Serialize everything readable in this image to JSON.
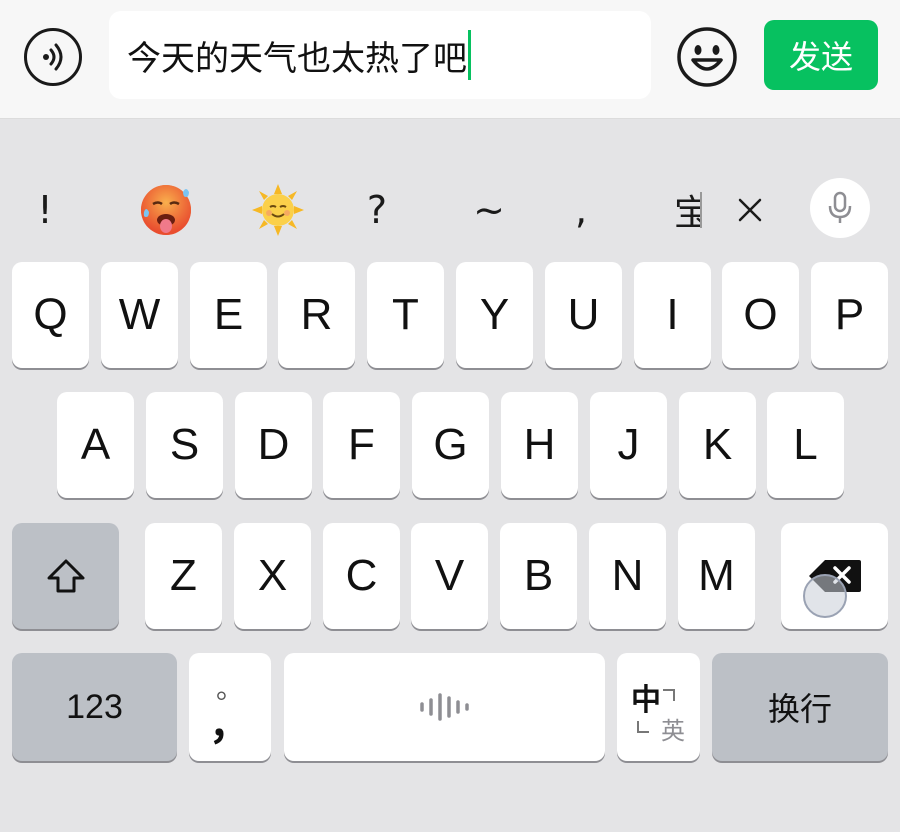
{
  "input_bar": {
    "voice_icon": "voice-wave-icon",
    "text_value": "今天的天气也太热了吧",
    "emoji_icon": "smiley-face-icon",
    "send_label": "发送",
    "accent_color": "#07c160"
  },
  "candidates": {
    "items": [
      {
        "type": "text",
        "label": "!"
      },
      {
        "type": "emoji",
        "icon": "hot-face-emoji"
      },
      {
        "type": "emoji",
        "icon": "sun-with-face-emoji"
      },
      {
        "type": "text",
        "label": "?"
      },
      {
        "type": "text",
        "label": "~"
      },
      {
        "type": "text",
        "label": ","
      }
    ],
    "partial_label": "宝",
    "close_icon": "close-icon",
    "mic_icon": "microphone-icon"
  },
  "keyboard": {
    "row1": [
      "Q",
      "W",
      "E",
      "R",
      "T",
      "Y",
      "U",
      "I",
      "O",
      "P"
    ],
    "row2": [
      "A",
      "S",
      "D",
      "F",
      "G",
      "H",
      "J",
      "K",
      "L"
    ],
    "row3": [
      "Z",
      "X",
      "C",
      "V",
      "B",
      "N",
      "M"
    ],
    "shift_icon": "shift-arrow-icon",
    "delete_icon": "backspace-icon",
    "numbers_label": "123",
    "punct_top": "。",
    "punct_bottom": "，",
    "space_icon": "voice-bars-icon",
    "lang_main": "中",
    "lang_alt": "英",
    "return_label": "换行"
  }
}
